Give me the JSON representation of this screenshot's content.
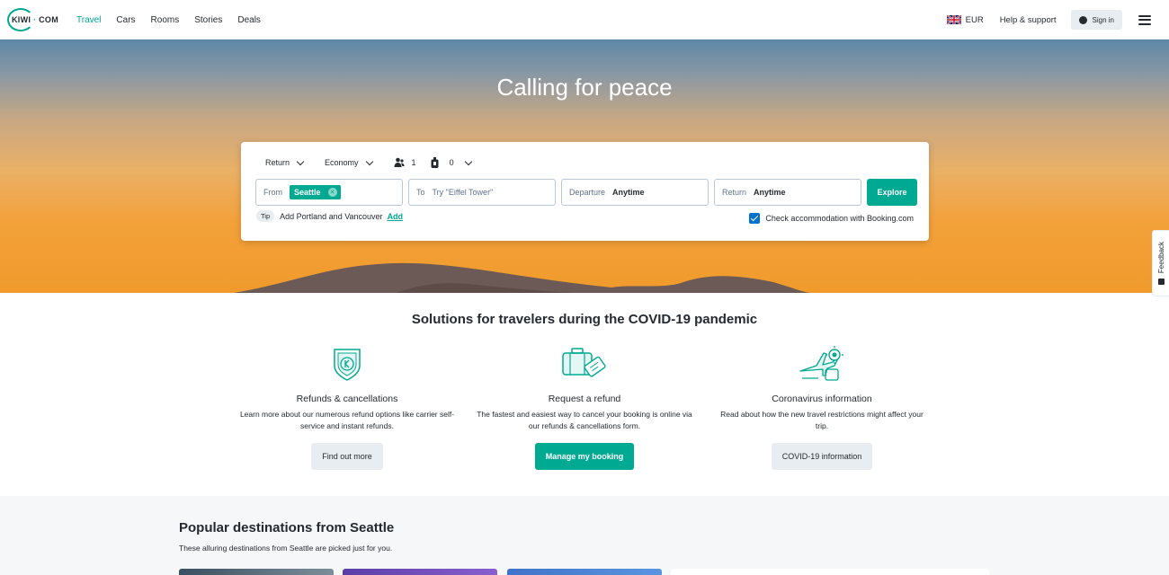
{
  "header": {
    "logo_text": "KIWI",
    "logo_domain": "COM",
    "nav": [
      {
        "label": "Travel",
        "active": true
      },
      {
        "label": "Cars",
        "active": false
      },
      {
        "label": "Rooms",
        "active": false
      },
      {
        "label": "Stories",
        "active": false
      },
      {
        "label": "Deals",
        "active": false
      }
    ],
    "currency": "EUR",
    "help": "Help & support",
    "signin": "Sign in"
  },
  "hero": {
    "title": "Calling for peace"
  },
  "search": {
    "trip_type": "Return",
    "cabin": "Economy",
    "passengers": "1",
    "bags": "0",
    "from_label": "From",
    "from_value": "Seattle",
    "to_label": "To",
    "to_placeholder": "Try \"Eiffel Tower\"",
    "departure_label": "Departure",
    "departure_value": "Anytime",
    "return_label": "Return",
    "return_value": "Anytime",
    "explore": "Explore",
    "tip_badge": "Tip",
    "tip_text": "Add Portland and Vancouver",
    "tip_action": "Add",
    "booking_check": "Check accommodation with Booking.com"
  },
  "feedback": "Feedback",
  "covid": {
    "title": "Solutions for travelers during the COVID-19 pandemic",
    "cards": [
      {
        "icon": "shield-refund-icon",
        "heading": "Refunds & cancellations",
        "text": "Learn more about our numerous refund options like carrier self-service and instant refunds.",
        "button": "Find out more"
      },
      {
        "icon": "luggage-ticket-icon",
        "heading": "Request a refund",
        "text": "The fastest and easiest way to cancel your booking is online via our refunds & cancellations form.",
        "button": "Manage my booking"
      },
      {
        "icon": "plane-virus-icon",
        "heading": "Coronavirus information",
        "text": "Read about how the new travel restrictions might affect your trip.",
        "button": "COVID-19 information"
      }
    ]
  },
  "popular": {
    "title": "Popular destinations from Seattle",
    "subtitle": "These alluring destinations from Seattle are picked just for you."
  },
  "colors": {
    "accent": "#00a991",
    "text": "#252a31",
    "checkbox": "#0172cb"
  }
}
